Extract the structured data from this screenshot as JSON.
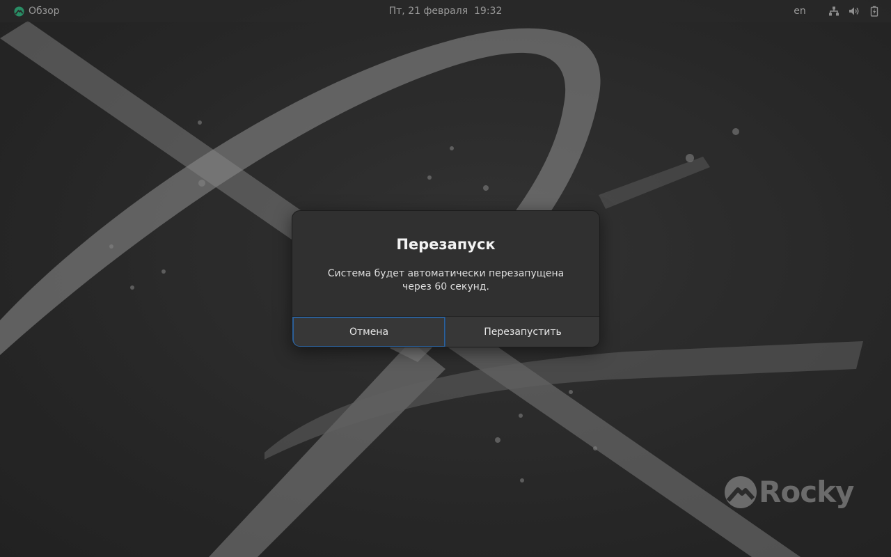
{
  "top_bar": {
    "activities_label": "Обзор",
    "clock": "Пт, 21 февраля  19:32",
    "keyboard_layout": "en",
    "icons": [
      "network-wired-icon",
      "volume-icon",
      "battery-charging-icon"
    ]
  },
  "dialog": {
    "title": "Перезапуск",
    "message": "Система будет автоматически перезапущена через 60 секунд.",
    "cancel_label": "Отмена",
    "restart_label": "Перезапустить"
  },
  "watermark": {
    "text": "Rocky"
  },
  "colors": {
    "desktop_bg": "#2f2f2f",
    "dialog_bg": "#303030",
    "focus_ring": "#2c5f97",
    "rocky_green": "#10b981"
  }
}
